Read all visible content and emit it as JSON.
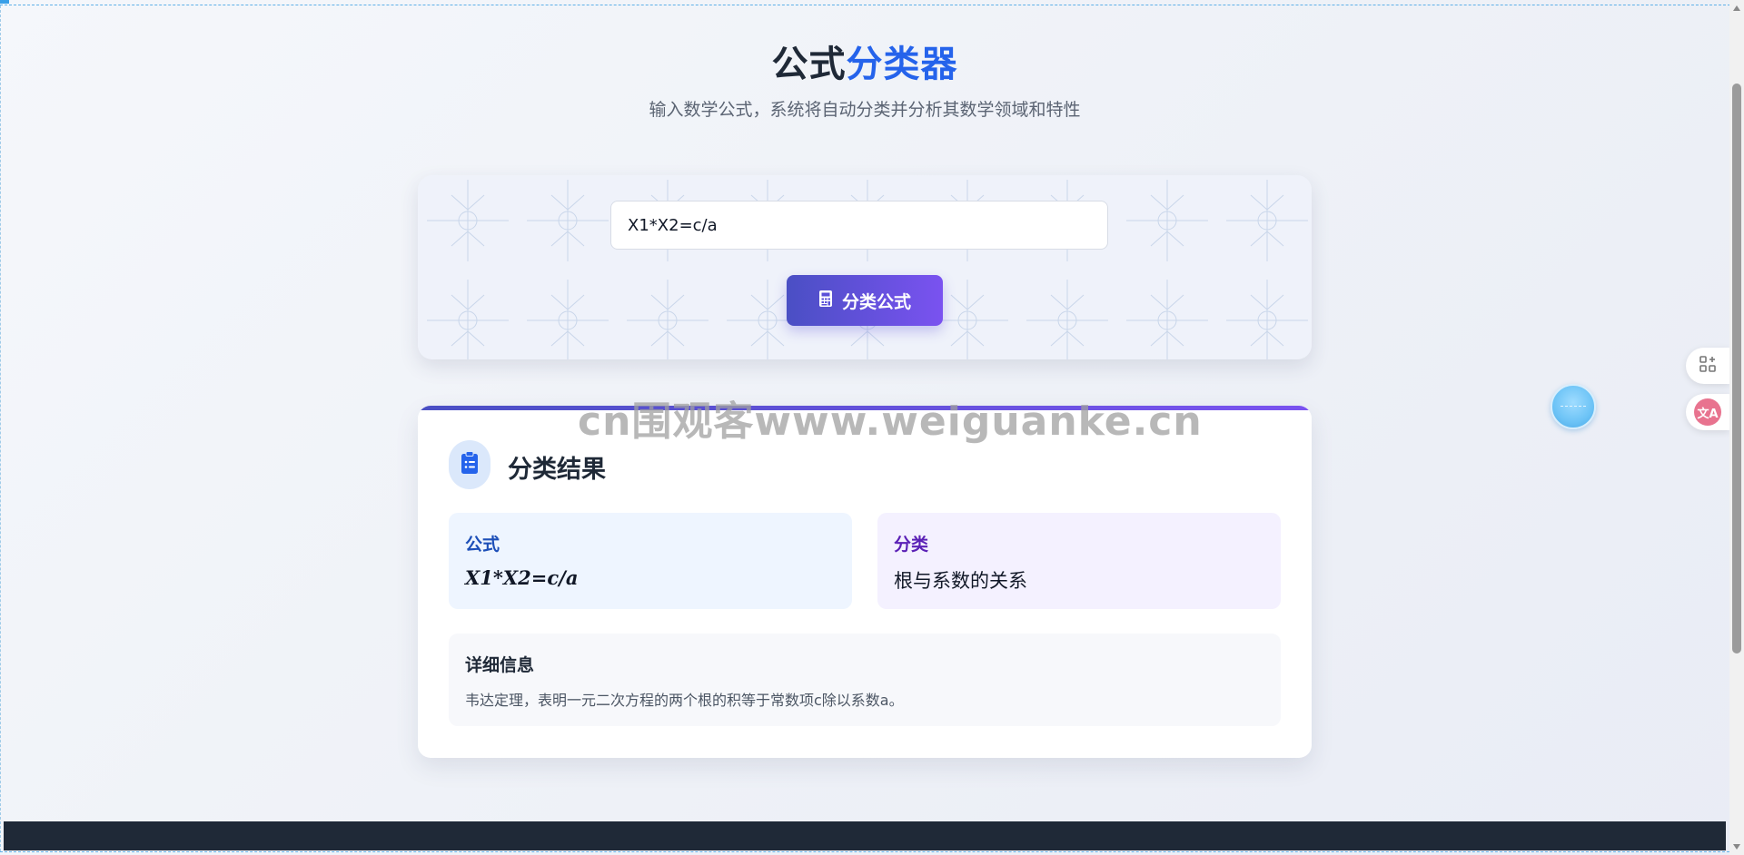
{
  "header": {
    "title_part1": "公式",
    "title_part2": "分类器",
    "subtitle": "输入数学公式，系统将自动分类并分析其数学领域和特性"
  },
  "input": {
    "value": "X1*X2=c/a",
    "button_label": "分类公式",
    "button_icon": "calculator-icon"
  },
  "result": {
    "title": "分类结果",
    "icon": "clipboard-list-icon",
    "formula_label": "公式",
    "formula_value": "X1*X2=c/a",
    "category_label": "分类",
    "category_value": "根与系数的关系",
    "details_label": "详细信息",
    "details_text": "韦达定理，表明一元二次方程的两个根的积等于常数项c除以系数a。"
  },
  "watermark": "cn围观客www.weiguanke.cn",
  "side_tools": [
    "grid-add-icon",
    "translate-icon"
  ],
  "side_tools_text": {
    "translate_label": "文A"
  },
  "colors": {
    "accent_blue": "#2563eb",
    "button_gradient_start": "#4a4fc4",
    "button_gradient_end": "#7a52f0",
    "footer": "#1f2937"
  }
}
